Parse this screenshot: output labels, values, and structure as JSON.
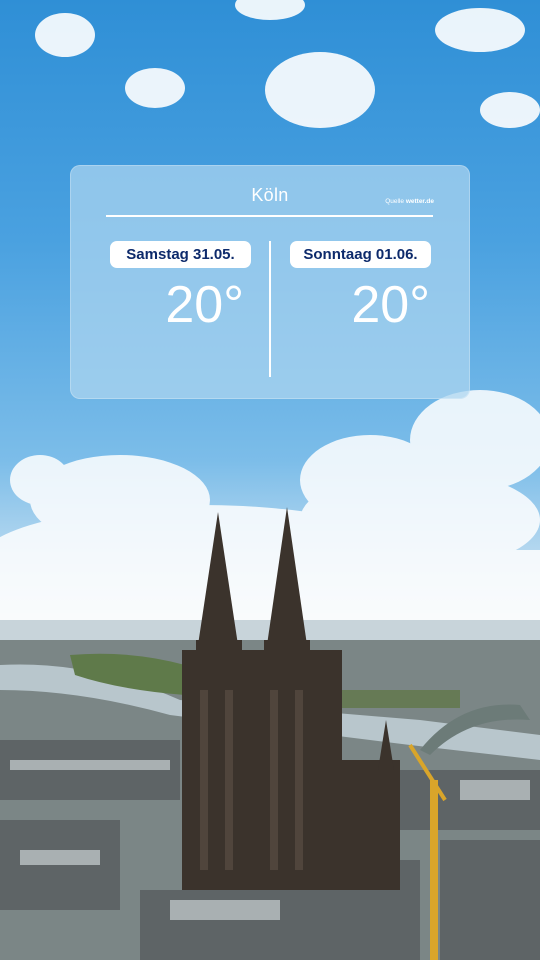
{
  "weather_card": {
    "city": "Köln",
    "source_prefix": "Quelle",
    "source_site": "wetter.de",
    "days": [
      {
        "label": "Samstag 31.05.",
        "temperature": "20°"
      },
      {
        "label": "Sonntaag 01.06.",
        "temperature": "20°"
      }
    ]
  },
  "colors": {
    "pill_text": "#0d2a6b",
    "sky_top": "#2f8fd6",
    "card_background": "#add6f0"
  }
}
